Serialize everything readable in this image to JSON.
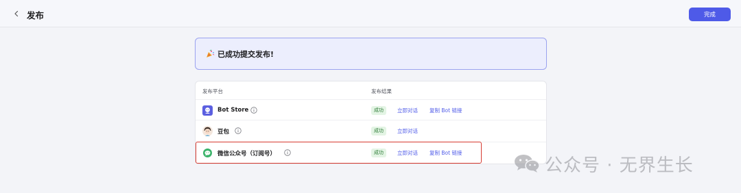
{
  "header": {
    "title": "发布",
    "done_label": "完成"
  },
  "banner": {
    "text": "已成功提交发布!"
  },
  "table": {
    "col_platform": "发布平台",
    "col_result": "发布结果",
    "rows": [
      {
        "name": "Bot Store",
        "status": "成功",
        "action_chat": "立即对话",
        "action_copy": "复制 Bot 链接"
      },
      {
        "name": "豆包",
        "status": "成功",
        "action_chat": "立即对话"
      },
      {
        "name": "微信公众号（订阅号）",
        "status": "成功",
        "action_chat": "立即对话",
        "action_copy": "复制 Bot 链接"
      }
    ]
  },
  "watermark": {
    "text": "公众号 · 无界生长"
  },
  "colors": {
    "accent": "#4e5ae8",
    "success_bg": "#e3f4e4",
    "success_text": "#2f7d38",
    "highlight": "#d6392f"
  }
}
